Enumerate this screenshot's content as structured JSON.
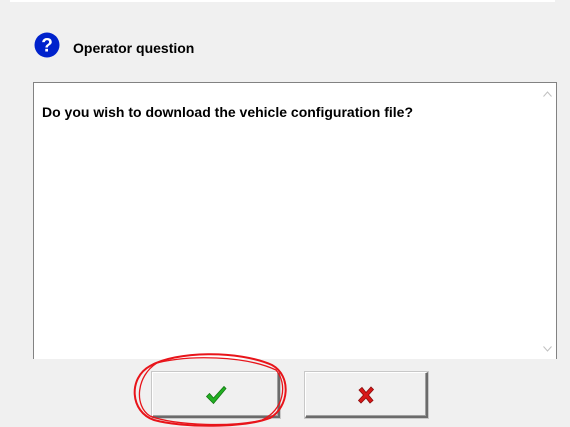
{
  "dialog": {
    "title": "Operator question",
    "message": "Do you wish to download the vehicle configuration file?",
    "icon": "question-icon"
  },
  "buttons": {
    "ok": {
      "icon": "checkmark-icon",
      "color": "#21b021"
    },
    "cancel": {
      "icon": "red-x-icon",
      "color": "#d81818"
    }
  },
  "annotation": {
    "shape": "hand-drawn-ellipse",
    "color": "#e8141a",
    "target": "ok-button"
  },
  "colors": {
    "question_icon": "#0022cc",
    "background": "#f0f0f0"
  }
}
